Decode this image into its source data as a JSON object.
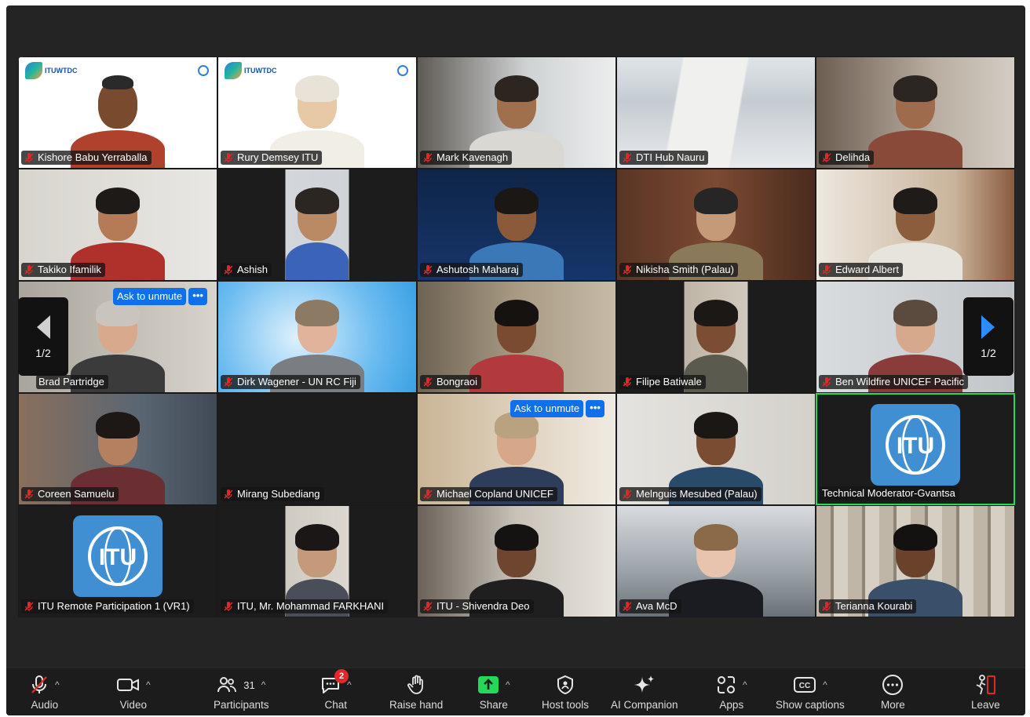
{
  "pager": {
    "left_label": "1/2",
    "right_label": "1/2"
  },
  "ask_to_unmute": {
    "label": "Ask to unmute",
    "more": "•••"
  },
  "tiles": [
    {
      "name": "Kishore Babu Yerraballa"
    },
    {
      "name": "Rury Demsey ITU"
    },
    {
      "name": "Mark Kavenagh"
    },
    {
      "name": "DTI Hub Nauru"
    },
    {
      "name": "Delihda"
    },
    {
      "name": "Takiko Ifamilik"
    },
    {
      "name": "Ashish"
    },
    {
      "name": "Ashutosh Maharaj"
    },
    {
      "name": "Nikisha Smith (Palau)"
    },
    {
      "name": "Edward Albert"
    },
    {
      "name": "Brad Partridge"
    },
    {
      "name": "Dirk Wagener - UN RC Fiji"
    },
    {
      "name": "Bongraoi"
    },
    {
      "name": "Filipe Batiwale"
    },
    {
      "name": "Ben Wildfire UNICEF Pacific"
    },
    {
      "name": "Coreen Samuelu"
    },
    {
      "name": "Mirang Subediang"
    },
    {
      "name": "Michael Copland UNICEF"
    },
    {
      "name": "Melnguis Mesubed (Palau)"
    },
    {
      "name": "Technical Moderator-Gvantsa"
    },
    {
      "name": "ITU Remote Participation 1 (VR1)"
    },
    {
      "name": "ITU, Mr. Mohammad FARKHANI"
    },
    {
      "name": "ITU - Shivendra Deo"
    },
    {
      "name": "Ava McD"
    },
    {
      "name": "Terianna Kourabi"
    }
  ],
  "toolbar": {
    "audio": "Audio",
    "video": "Video",
    "participants": "Participants",
    "participants_count": "31",
    "chat": "Chat",
    "chat_badge": "2",
    "raise_hand": "Raise hand",
    "share": "Share",
    "host_tools": "Host tools",
    "ai_companion": "AI Companion",
    "apps": "Apps",
    "show_captions": "Show captions",
    "more": "More",
    "leave": "Leave"
  },
  "colors": {
    "accent": "#0e71eb",
    "active_border": "#23d959",
    "share_green": "#23d959",
    "badge_red": "#e02828",
    "mute_red": "#e02828"
  }
}
